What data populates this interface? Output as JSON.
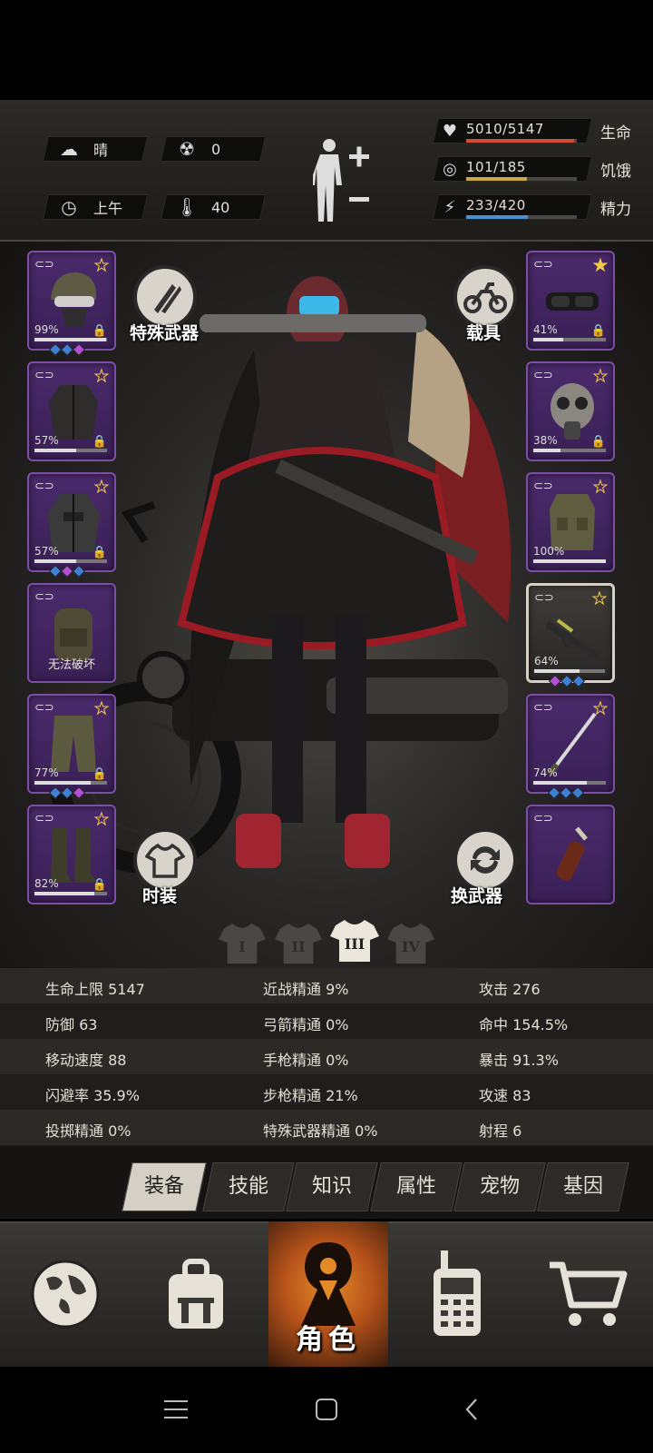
{
  "hud": {
    "weather": "晴",
    "radiation": "0",
    "time_of_day": "上午",
    "temperature": "40",
    "stats": [
      {
        "value": "5010/5147",
        "label": "生命",
        "fraction": 0.973,
        "color": "#d24b34",
        "icon": "heart-pulse-icon"
      },
      {
        "value": "101/185",
        "label": "饥饿",
        "fraction": 0.546,
        "color": "#c9a84a",
        "icon": "stomach-icon"
      },
      {
        "value": "233/420",
        "label": "精力",
        "fraction": 0.555,
        "color": "#4a8fd1",
        "icon": "energy-head-icon"
      }
    ]
  },
  "left_slots": [
    {
      "pct": "99%",
      "durability": 0.99,
      "locked": true,
      "star": "outline",
      "gems": [
        "#3f7fd6",
        "#3f7fd6",
        "#b44fd6"
      ],
      "item": "helmet"
    },
    {
      "pct": "57%",
      "durability": 0.57,
      "locked": true,
      "star": "outline",
      "gems": [],
      "item": "jacket"
    },
    {
      "pct": "57%",
      "durability": 0.57,
      "locked": true,
      "star": "outline",
      "gems": [
        "#3f7fd6",
        "#b44fd6",
        "#3f7fd6"
      ],
      "item": "coat"
    },
    {
      "pct": "",
      "durability": 0,
      "locked": false,
      "star": "none",
      "gems": [],
      "item": "backpack",
      "note": "无法破坏"
    },
    {
      "pct": "77%",
      "durability": 0.77,
      "locked": true,
      "star": "outline",
      "gems": [
        "#3f7fd6",
        "#3f7fd6",
        "#b44fd6"
      ],
      "item": "pants"
    },
    {
      "pct": "82%",
      "durability": 0.82,
      "locked": true,
      "star": "outline",
      "gems": [],
      "item": "boots"
    }
  ],
  "right_slots": [
    {
      "pct": "41%",
      "durability": 0.41,
      "locked": true,
      "star": "gold",
      "gems": [],
      "item": "goggles"
    },
    {
      "pct": "38%",
      "durability": 0.38,
      "locked": true,
      "star": "outline",
      "gems": [],
      "item": "gasmask"
    },
    {
      "pct": "100%",
      "durability": 1.0,
      "locked": false,
      "star": "outline",
      "gems": [],
      "item": "vest"
    },
    {
      "pct": "64%",
      "durability": 0.64,
      "locked": false,
      "star": "outline",
      "gems": [
        "#b44fd6",
        "#3f7fd6",
        "#3f7fd6"
      ],
      "item": "rifle",
      "selected": true
    },
    {
      "pct": "74%",
      "durability": 0.74,
      "locked": false,
      "star": "outline",
      "gems": [
        "#3f7fd6",
        "#3f7fd6",
        "#3f7fd6"
      ],
      "item": "sword"
    },
    {
      "pct": "",
      "durability": 0,
      "locked": false,
      "star": "none",
      "gems": [],
      "item": "molotov"
    }
  ],
  "buttons": {
    "special_weapon": "特殊武器",
    "vehicle": "载具",
    "fashion": "时装",
    "swap_weapon": "换武器"
  },
  "outfits": [
    "I",
    "II",
    "III",
    "IV"
  ],
  "active_outfit": 2,
  "stats_table": [
    [
      "生命上限 5147",
      "近战精通 9%",
      "攻击 276"
    ],
    [
      "防御 63",
      "弓箭精通 0%",
      "命中 154.5%"
    ],
    [
      "移动速度 88",
      "手枪精通 0%",
      "暴击 91.3%"
    ],
    [
      "闪避率 35.9%",
      "步枪精通 21%",
      "攻速 83"
    ],
    [
      "投掷精通 0%",
      "特殊武器精通 0%",
      "射程 6"
    ]
  ],
  "tabs": [
    "装备",
    "技能",
    "知识",
    "属性",
    "宠物",
    "基因"
  ],
  "active_tab": 0,
  "nav": {
    "items": [
      "globe-icon",
      "backpack-icon",
      "character-icon",
      "radio-icon",
      "cart-icon"
    ],
    "active_label": "角色"
  }
}
